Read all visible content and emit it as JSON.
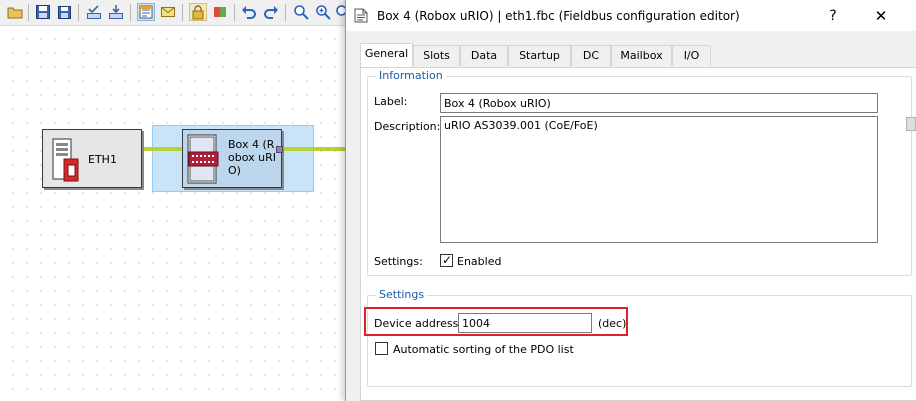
{
  "toolbar": {
    "icons": [
      "open-icon",
      "save-icon",
      "save-all-icon",
      "check-icon",
      "download-icon",
      "properties-icon",
      "message-icon",
      "lock-icon",
      "toggle-icon",
      "undo-icon",
      "redo-icon",
      "zoom-fit-icon",
      "zoom-in-icon",
      "zoom-out-icon"
    ]
  },
  "canvas": {
    "nodes": [
      {
        "label": "ETH1"
      },
      {
        "label": "Box 4 (Robox uRIO)"
      }
    ]
  },
  "dialog": {
    "title": "Box 4 (Robox uRIO) | eth1.fbc (Fieldbus configuration editor)",
    "help_label": "?",
    "close_label": "✕",
    "tabs": [
      "General",
      "Slots",
      "Data",
      "Startup",
      "DC",
      "Mailbox",
      "I/O"
    ],
    "active_tab": "General",
    "information": {
      "group_title": "Information",
      "label_caption": "Label:",
      "label_value": "Box 4 (Robox uRIO)",
      "description_caption": "Description:",
      "description_value": "uRIO AS3039.001 (CoE/FoE)",
      "settings_caption": "Settings:",
      "enabled_label": "Enabled",
      "enabled_checked": true
    },
    "settings": {
      "group_title": "Settings",
      "device_address_caption": "Device address:",
      "device_address_value": "1004",
      "device_address_unit": "(dec)",
      "auto_sort_label": "Automatic sorting of the PDO list",
      "auto_sort_checked": false
    }
  },
  "colors": {
    "selection": "#c9e3f8",
    "wire": "#b6d235",
    "group_title": "#1a5ba3",
    "highlight": "#e2202b"
  }
}
